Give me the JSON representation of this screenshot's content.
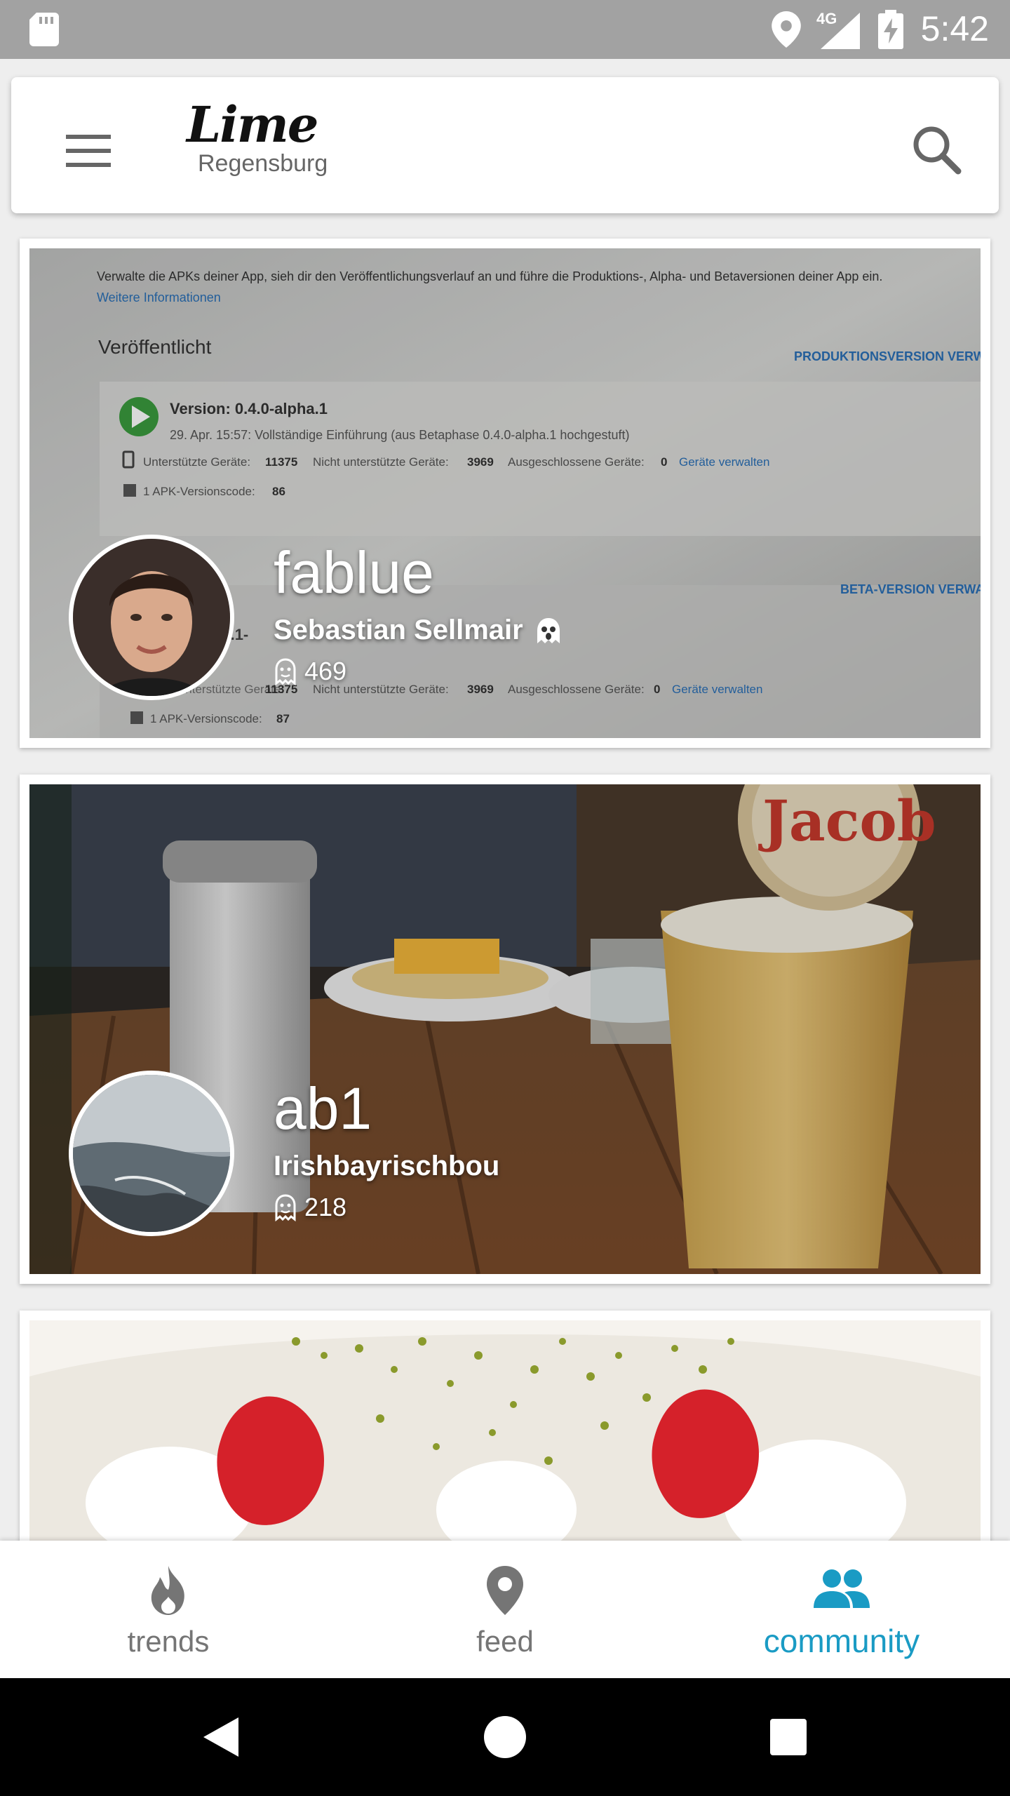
{
  "status_bar": {
    "time": "5:42",
    "network": "4G",
    "icons": [
      "sd-card-icon",
      "location-icon",
      "signal-icon",
      "battery-charging-icon"
    ]
  },
  "app_bar": {
    "logo_text": "Lime",
    "city": "Regensburg",
    "icons": [
      "menu-icon",
      "search-icon"
    ]
  },
  "community": {
    "members": [
      {
        "username": "fablue",
        "name": "Sebastian Sellmair",
        "badge_icon": "ghost-icon",
        "karma": "469"
      },
      {
        "username": "ab1",
        "name": "Irishbayrischbou",
        "karma": "218"
      }
    ]
  },
  "card_images": {
    "screenshot": {
      "line1": "Verwalte die APKs deiner App, sieh dir den Veröffentlichungsverlauf an und führe die Produktions-, Alpha- und Betaversionen deiner App ein.",
      "link": "Weitere Informationen",
      "heading": "Veröffentlicht",
      "prod_action": "PRODUKTIONSVERSION VERW",
      "version": "Version: 0.4.0-alpha.1",
      "release_note": "29. Apr. 15:57: Vollständige Einführung (aus Betaphase 0.4.0-alpha.1 hochgestuft)",
      "supported_label": "Unterstützte Geräte:",
      "supported_value": "11375",
      "unsupported_label": "Nicht unterstützte Geräte:",
      "unsupported_value": "3969",
      "excluded_label": "Ausgeschlossene Geräte:",
      "excluded_value": "0",
      "manage_link": "Geräte verwalten",
      "apk_code": "1 APK-Versionscode:",
      "apk_value": "86",
      "beta_action": "BETA-VERSION VERWA",
      "apk_value_2": "87"
    },
    "beer_label": "Jacob"
  },
  "bottom_nav": {
    "items": [
      {
        "label": "trends",
        "icon": "flame-icon",
        "active": false
      },
      {
        "label": "feed",
        "icon": "location-pin-icon",
        "active": false
      },
      {
        "label": "community",
        "icon": "people-icon",
        "active": true
      }
    ],
    "active_color": "#1a9bc4",
    "inactive_color": "#757575"
  },
  "system_nav": {
    "icons": [
      "back-icon",
      "home-icon",
      "recents-icon"
    ]
  }
}
